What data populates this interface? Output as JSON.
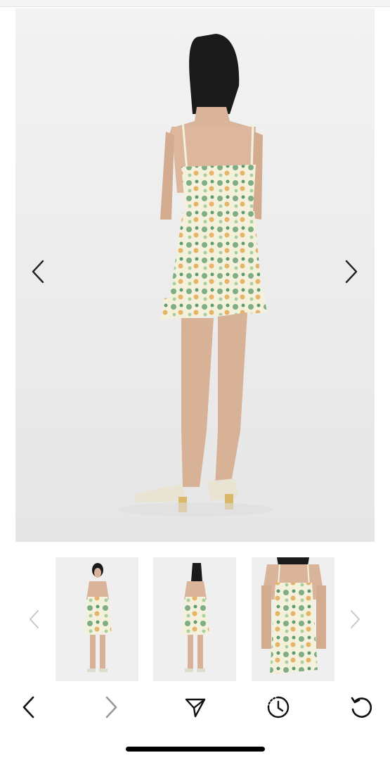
{
  "gallery": {
    "main_image_alt": "",
    "current_index": 1,
    "thumbnail_count": 3
  },
  "colors": {
    "background": "#ffffff",
    "photo_bg": "#ececec",
    "arrow_active": "#222222",
    "arrow_inactive": "#c8c8c8",
    "dress_base": "#f3f1dc",
    "dress_green": "#7fae84",
    "dress_orange": "#e6b36a",
    "toolbar_icon": "#111111",
    "toolbar_icon_disabled": "#9a9a9a"
  },
  "icons": {
    "main_prev": "chevron-left-icon",
    "main_next": "chevron-right-icon",
    "thumb_prev": "chevron-left-icon",
    "thumb_next": "chevron-right-icon",
    "back": "back-arrow-icon",
    "forward": "forward-arrow-icon",
    "share": "send-icon",
    "history": "history-clock-icon",
    "reload": "reload-icon"
  },
  "toolbar": {
    "forward_enabled": false
  }
}
